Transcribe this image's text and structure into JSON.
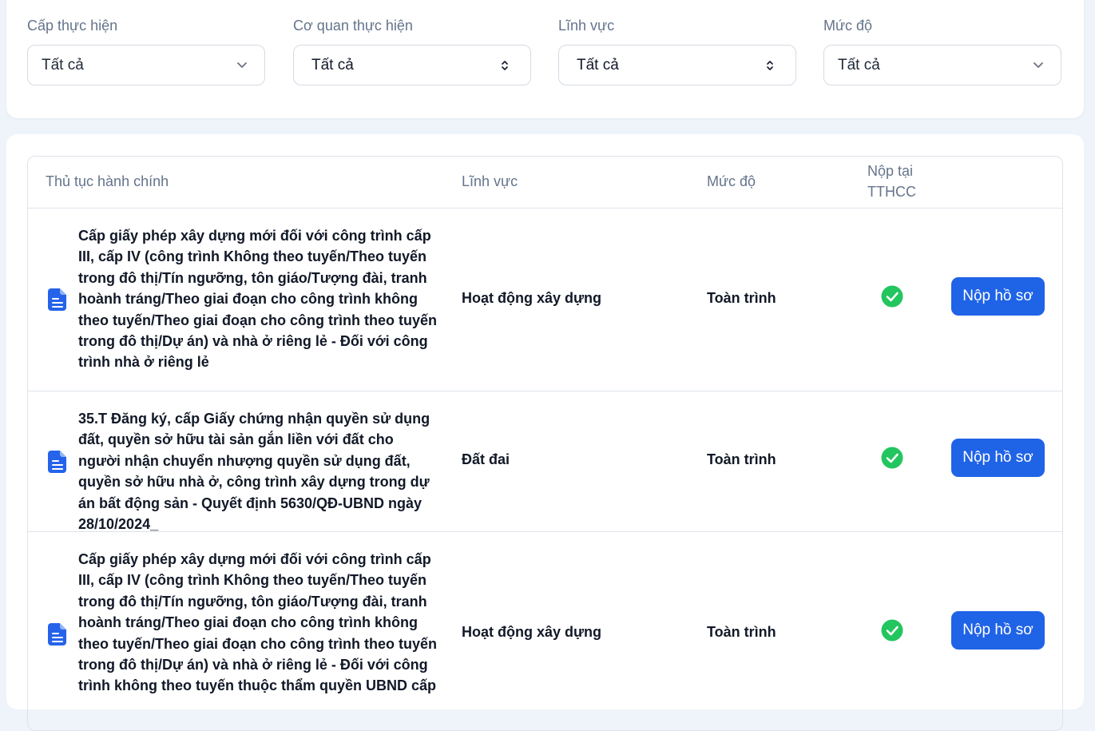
{
  "filters": {
    "cap_thuc_hien": {
      "label": "Cấp thực hiện",
      "value": "Tất cả"
    },
    "co_quan_thuc_hien": {
      "label": "Cơ quan thực hiện",
      "value": "Tất cả"
    },
    "linh_vuc": {
      "label": "Lĩnh vực",
      "value": "Tất cả"
    },
    "muc_do": {
      "label": "Mức độ",
      "value": "Tất cả"
    }
  },
  "table": {
    "headers": {
      "procedure": "Thủ tục hành chính",
      "field": "Lĩnh vực",
      "level": "Mức độ",
      "submit_at_line1": "Nộp tại",
      "submit_at_line2": "TTHCC"
    },
    "rows": [
      {
        "procedure": "Cấp giấy phép xây dựng mới đối với công trình cấp III, cấp IV (công trình Không theo tuyến/Theo tuyến trong đô thị/Tín ngưỡng, tôn giáo/Tượng đài, tranh hoành tráng/Theo giai đoạn cho công trình không theo tuyến/Theo giai đoạn cho công trình theo tuyến trong đô thị/Dự án) và nhà ở riêng lẻ - Đối với công trình nhà ở riêng lẻ",
        "field": "Hoạt động xây dựng",
        "level": "Toàn trình",
        "submit_at_tthcc": true,
        "button": "Nộp hồ sơ"
      },
      {
        "procedure": "35.T Đăng ký, cấp Giấy chứng nhận quyền sử dụng đất, quyền sở hữu tài sản gắn liền với đất cho người nhận chuyển nhượng quyền sử dụng đất, quyền sở hữu nhà ở, công trình xây dựng trong dự án bất động sản - Quyết định 5630/QĐ-UBND ngày 28/10/2024_",
        "field": "Đất đai",
        "level": "Toàn trình",
        "submit_at_tthcc": true,
        "button": "Nộp hồ sơ"
      },
      {
        "procedure": "Cấp giấy phép xây dựng mới đối với công trình cấp III, cấp IV (công trình Không theo tuyến/Theo tuyến trong đô thị/Tín ngưỡng, tôn giáo/Tượng đài, tranh hoành tráng/Theo giai đoạn cho công trình không theo tuyến/Theo giai đoạn cho công trình theo tuyến trong đô thị/Dự án) và nhà ở riêng lẻ - Đối với công trình không theo tuyến thuộc thẩm quyền UBND cấp",
        "field": "Hoạt động xây dựng",
        "level": "Toàn trình",
        "submit_at_tthcc": true,
        "button": "Nộp hồ sơ"
      }
    ]
  },
  "icons": {
    "document": "document-icon",
    "check": "check-circle-icon",
    "chevron": "chevron-down-icon",
    "updown": "chevron-up-down-icon"
  },
  "colors": {
    "primary_button": "#1f63e6",
    "check_green": "#22c55e",
    "doc_icon_blue": "#2563eb",
    "page_bg": "#eef4f9"
  }
}
